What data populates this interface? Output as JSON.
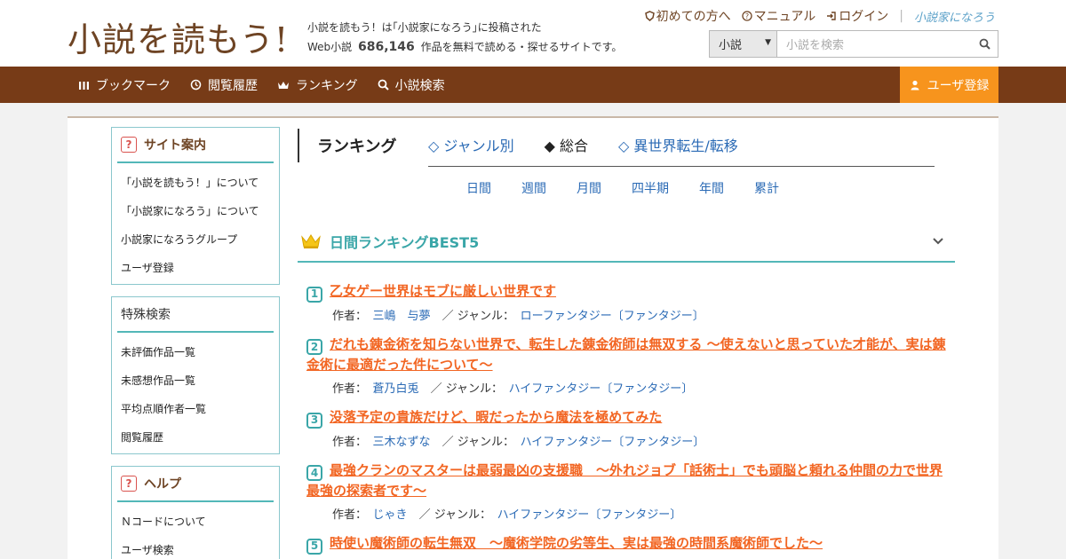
{
  "header": {
    "logo": "小説を読もう!",
    "tagline_line1": "小説を読もう！は｢小説家になろう｣に投稿された",
    "tagline_pre": "Web小説",
    "work_count": "686,146",
    "tagline_post": "作品を無料で読める・探せるサイトです。",
    "links": {
      "beginner": "初めての方へ",
      "manual": "マニュアル",
      "login": "ログイン"
    },
    "narou_logo": "小説家になろう",
    "search": {
      "select_value": "小説",
      "placeholder": "小説を検索"
    }
  },
  "nav": {
    "items": [
      "ブックマーク",
      "閲覧履歴",
      "ランキング",
      "小説検索"
    ],
    "register": "ユーザ登録"
  },
  "sidebar": {
    "guide": {
      "title": "サイト案内",
      "items": [
        "「小説を読もう！」について",
        "「小説家になろう」について",
        "小説家になろうグループ",
        "ユーザ登録"
      ]
    },
    "special": {
      "title": "特殊検索",
      "items": [
        "未評価作品一覧",
        "未感想作品一覧",
        "平均点順作者一覧",
        "閲覧履歴"
      ]
    },
    "help": {
      "title": "ヘルプ",
      "items": [
        "Ｎコードについて",
        "ユーザ検索"
      ]
    }
  },
  "ranking": {
    "heading": "ランキング",
    "tabs": [
      "◇ ジャンル別",
      "◆ 総合",
      "◇ 異世界転生/転移"
    ],
    "periods": [
      "日間",
      "週間",
      "月間",
      "四半期",
      "年間",
      "累計"
    ],
    "best_title": "日間ランキングBEST5",
    "author_label": "作者：",
    "genre_label": "／ ジャンル：",
    "entries": [
      {
        "num": "1",
        "title": "乙女ゲー世界はモブに厳しい世界です",
        "author": "三嶋　与夢",
        "genre": "ローファンタジー〔ファンタジー〕"
      },
      {
        "num": "2",
        "title": "だれも錬金術を知らない世界で、転生した錬金術師は無双する 〜使えないと思っていた才能が、実は錬金術に最適だった件について〜",
        "author": "蒼乃白兎",
        "genre": "ハイファンタジー〔ファンタジー〕"
      },
      {
        "num": "3",
        "title": "没落予定の貴族だけど、暇だったから魔法を極めてみた",
        "author": "三木なずな",
        "genre": "ハイファンタジー〔ファンタジー〕"
      },
      {
        "num": "4",
        "title": "最強クランのマスターは最弱最凶の支援職　～外れジョブ「話術士」でも頭脳と頼れる仲間の力で世界最強の探索者です～",
        "author": "じゃき",
        "genre": "ハイファンタジー〔ファンタジー〕"
      },
      {
        "num": "5",
        "title": "時使い魔術師の転生無双　～魔術学院の劣等生、実は最強の時間系魔術師でした～",
        "author": "",
        "genre": ""
      }
    ]
  }
}
